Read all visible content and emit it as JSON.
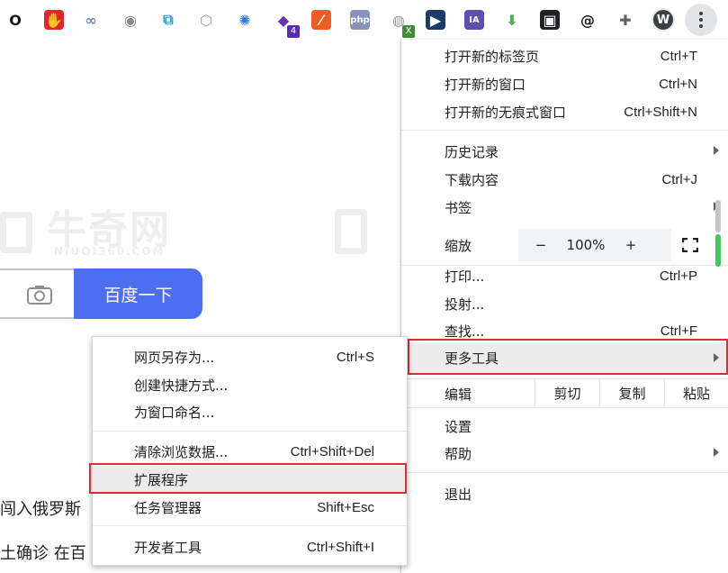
{
  "toolbar": {
    "extensions": [
      {
        "name": "opera-icon",
        "glyph": "O",
        "bg": "#ffffff",
        "fg": "#111111"
      },
      {
        "name": "adblock-icon",
        "glyph": "✋",
        "bg": "#e0262c",
        "fg": "#ffffff"
      },
      {
        "name": "link-icon",
        "glyph": "∞",
        "bg": "#ffffff",
        "fg": "#7a8ba8"
      },
      {
        "name": "camera-icon",
        "glyph": "◉",
        "bg": "#ffffff",
        "fg": "#8a8a8a"
      },
      {
        "name": "screen-capture-icon",
        "glyph": "⧉",
        "bg": "#ffffff",
        "fg": "#1aa3d8"
      },
      {
        "name": "hexagon-icon",
        "glyph": "⬡",
        "bg": "#ffffff",
        "fg": "#9e9e9e"
      },
      {
        "name": "globe-icon",
        "glyph": "✺",
        "bg": "#ffffff",
        "fg": "#2a7bd8"
      },
      {
        "name": "layers-icon",
        "glyph": "◆",
        "bg": "#ffffff",
        "fg": "#6a2fb3",
        "badge": "4",
        "badge_bg": "#5a2bb0"
      },
      {
        "name": "tampermonkey-icon",
        "glyph": "⁄",
        "bg": "#f05a24",
        "fg": "#ffffff"
      },
      {
        "name": "php-icon",
        "glyph": "php",
        "bg": "#8892bf",
        "fg": "#ffffff"
      },
      {
        "name": "world-icon",
        "glyph": "◍",
        "bg": "#ffffff",
        "fg": "#9a9a9a",
        "badge": "X",
        "badge_bg": "#3f8c3a"
      },
      {
        "name": "video-icon",
        "glyph": "▶",
        "bg": "#1b3b6f",
        "fg": "#ffffff"
      },
      {
        "name": "ia-icon",
        "glyph": "IA",
        "bg": "#5b4fb0",
        "fg": "#ffffff"
      },
      {
        "name": "download-arrow-icon",
        "glyph": "⬇",
        "bg": "#ffffff",
        "fg": "#4caf50"
      },
      {
        "name": "tab-icon",
        "glyph": "▣",
        "bg": "#202124",
        "fg": "#ffffff"
      },
      {
        "name": "spiral-icon",
        "glyph": "@",
        "bg": "#ffffff",
        "fg": "#202124"
      },
      {
        "name": "puzzle-icon",
        "glyph": "✚",
        "bg": "#ffffff",
        "fg": "#5f6368"
      }
    ],
    "avatar_letter": "W"
  },
  "page": {
    "search_button": "百度一下",
    "news": [
      "闯入俄罗斯",
      "土确诊 在百"
    ],
    "watermark_text": "牛奇网",
    "watermark_sub": "NIUQI360.COM"
  },
  "menu": {
    "items": [
      {
        "label": "打开新的标签页",
        "shortcut": "Ctrl+T"
      },
      {
        "label": "打开新的窗口",
        "shortcut": "Ctrl+N"
      },
      {
        "label": "打开新的无痕式窗口",
        "shortcut": "Ctrl+Shift+N"
      },
      {
        "label": "历史记录",
        "shortcut": ""
      },
      {
        "label": "下载内容",
        "shortcut": "Ctrl+J"
      },
      {
        "label": "书签",
        "shortcut": ""
      },
      {
        "label": "打印...",
        "shortcut": "Ctrl+P"
      },
      {
        "label": "投射...",
        "shortcut": ""
      },
      {
        "label": "查找...",
        "shortcut": "Ctrl+F"
      },
      {
        "label": "更多工具",
        "shortcut": ""
      },
      {
        "label": "设置",
        "shortcut": ""
      },
      {
        "label": "帮助",
        "shortcut": ""
      },
      {
        "label": "退出",
        "shortcut": ""
      }
    ],
    "zoom": {
      "label": "缩放",
      "minus": "−",
      "value": "100%",
      "plus": "+"
    },
    "edit": {
      "label": "编辑",
      "cut": "剪切",
      "copy": "复制",
      "paste": "粘贴"
    }
  },
  "submenu": {
    "items": [
      {
        "label": "网页另存为...",
        "shortcut": "Ctrl+S"
      },
      {
        "label": "创建快捷方式...",
        "shortcut": ""
      },
      {
        "label": "为窗口命名...",
        "shortcut": ""
      },
      {
        "label": "清除浏览数据...",
        "shortcut": "Ctrl+Shift+Del"
      },
      {
        "label": "扩展程序",
        "shortcut": ""
      },
      {
        "label": "任务管理器",
        "shortcut": "Shift+Esc"
      },
      {
        "label": "开发者工具",
        "shortcut": "Ctrl+Shift+I"
      }
    ]
  },
  "colors": {
    "highlight_box": "#d93035",
    "baidu_blue": "#4e6ef2"
  }
}
